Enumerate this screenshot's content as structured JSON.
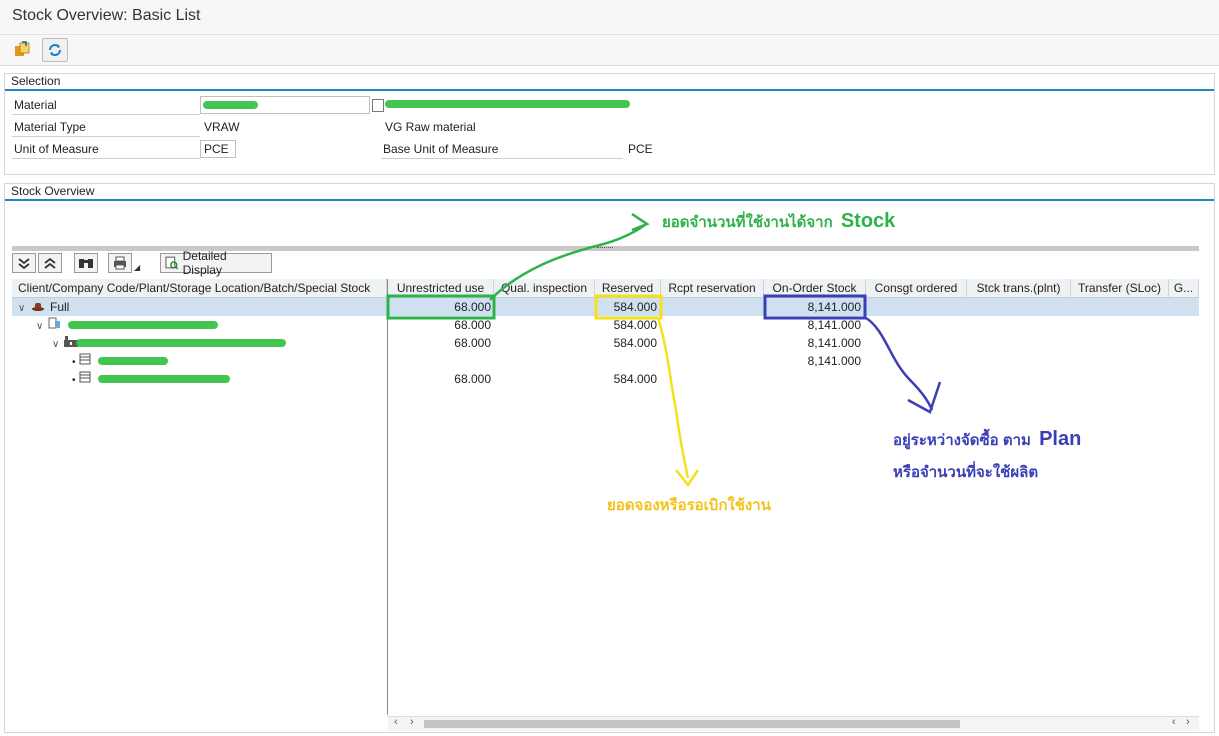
{
  "window": {
    "title": "Stock Overview: Basic List"
  },
  "toolbar": {
    "icons": [
      "export-icon",
      "refresh-icon"
    ]
  },
  "selection": {
    "title": "Selection",
    "material_label": "Material",
    "material_type_label": "Material Type",
    "material_type_value": "VRAW",
    "material_type_desc": "VG Raw material",
    "uom_label": "Unit of Measure",
    "uom_value": "PCE",
    "base_uom_label": "Base Unit of Measure",
    "base_uom_value": "PCE"
  },
  "overview": {
    "title": "Stock Overview",
    "detailed_display_label": "Detailed Display",
    "tree_header": "Client/Company Code/Plant/Storage Location/Batch/Special Stock",
    "root_label": "Full",
    "columns": [
      "Unrestricted use",
      "Qual. inspection",
      "Reserved",
      "Rcpt reservation",
      "On-Order Stock",
      "Consgt ordered",
      "Stck trans.(plnt)",
      "Transfer (SLoc)",
      "G..."
    ],
    "rows": [
      {
        "unrestricted": "68.000",
        "reserved": "584.000",
        "on_order": "8,141.000"
      },
      {
        "unrestricted": "68.000",
        "reserved": "584.000",
        "on_order": "8,141.000"
      },
      {
        "unrestricted": "68.000",
        "reserved": "584.000",
        "on_order": "8,141.000"
      },
      {
        "unrestricted": "",
        "reserved": "",
        "on_order": "8,141.000"
      },
      {
        "unrestricted": "68.000",
        "reserved": "584.000",
        "on_order": ""
      }
    ]
  },
  "annotations": {
    "green": {
      "thai": "ยอดจำนวนที่ใช้งานได้จาก",
      "en": "Stock",
      "color": "#2db34a"
    },
    "yellow": {
      "thai": "ยอดจองหรือรอเบิกใช้งาน",
      "color": "#f2c21a"
    },
    "blue": {
      "line1_thai": "อยู่ระหว่างจัดซื้อ ตาม",
      "line1_en": "Plan",
      "line2_thai": "หรือจำนวนที่จะใช้ผลิต",
      "color": "#3a3fb8"
    }
  }
}
